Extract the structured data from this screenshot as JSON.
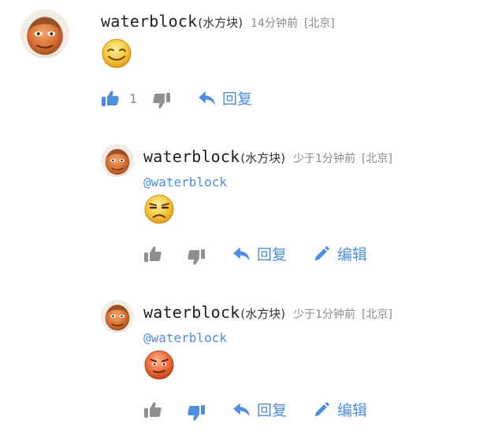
{
  "colors": {
    "accent_blue": "#4d8ede",
    "icon_gray": "#8f8f8f",
    "meta_gray": "#8a8a8a"
  },
  "comments": [
    {
      "username": "waterblock",
      "nickname": "(水方块)",
      "time": "14分钟前",
      "location": "[北京]",
      "mention": "",
      "emoji_icon": "smiling-face-emoji-icon",
      "likes": "1",
      "liked": true,
      "disliked": false,
      "reply_label": "回复",
      "edit_label": ""
    },
    {
      "username": "waterblock",
      "nickname": "(水方块)",
      "time": "少于1分钟前",
      "location": "[北京]",
      "mention": "@waterblock",
      "emoji_icon": "unamused-face-emoji-icon",
      "likes": "",
      "liked": false,
      "disliked": false,
      "reply_label": "回复",
      "edit_label": "编辑"
    },
    {
      "username": "waterblock",
      "nickname": "(水方块)",
      "time": "少于1分钟前",
      "location": "[北京]",
      "mention": "@waterblock",
      "emoji_icon": "red-face-emoji-icon",
      "likes": "",
      "liked": false,
      "disliked": true,
      "reply_label": "回复",
      "edit_label": "编辑"
    }
  ]
}
